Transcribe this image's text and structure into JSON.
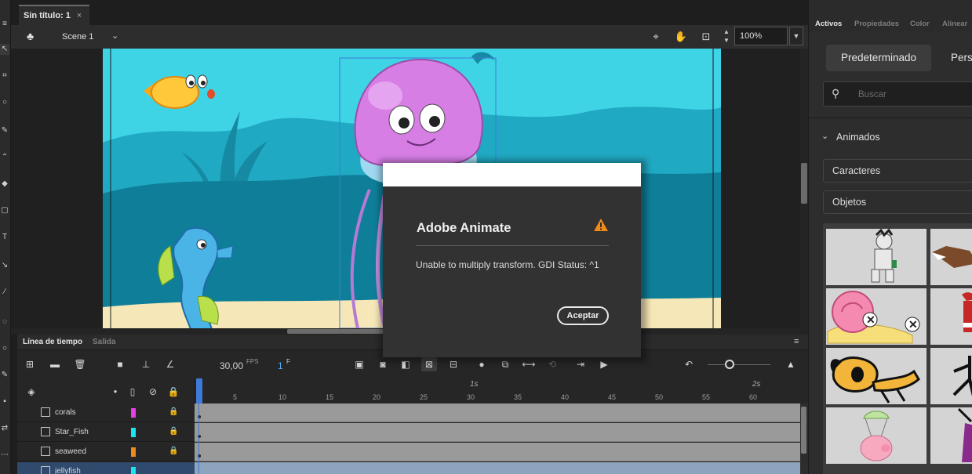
{
  "document_tab": {
    "title": "Sin título: 1",
    "close": "×"
  },
  "stage_bar": {
    "scene_label": "Scene 1",
    "zoom_value": "100%"
  },
  "timeline": {
    "tabs": [
      "Línea de tiempo",
      "Salida"
    ],
    "fps_value": "30,00",
    "fps_label": "FPS",
    "frame_value": "1",
    "frame_label": "F",
    "ruler_seconds": [
      "1s",
      "2s"
    ],
    "ruler_frames": [
      "5",
      "10",
      "15",
      "20",
      "25",
      "30",
      "35",
      "40",
      "45",
      "50",
      "55",
      "60"
    ],
    "layers": [
      {
        "name": "corals",
        "color": "#e83ee8"
      },
      {
        "name": "Star_Fish",
        "color": "#19e6f0"
      },
      {
        "name": "seaweed",
        "color": "#f08a19"
      },
      {
        "name": "jellyfish",
        "color": "#19e6f0"
      }
    ]
  },
  "right_panel": {
    "tabs": [
      "Activos",
      "Propiedades",
      "Color",
      "Alinear"
    ],
    "active_tab": "Activos",
    "button_default": "Predeterminado",
    "button_custom": "Perso",
    "search_placeholder": "Buscar",
    "section_label": "Animados",
    "dropdowns": [
      "Caracteres",
      "Objetos"
    ]
  },
  "dialog": {
    "title": "Adobe Animate",
    "message": "Unable to multiply transform. GDI Status: ^1",
    "ok_button": "Aceptar"
  },
  "colors": {
    "accent": "#3d7ad8",
    "warning": "#f08a19",
    "sea_light": "#3fd3e6",
    "sea_mid": "#1aa3bd",
    "sea_dark": "#0f7f99",
    "sand": "#f6e7b8",
    "jellyfish": "#d77ee5"
  }
}
